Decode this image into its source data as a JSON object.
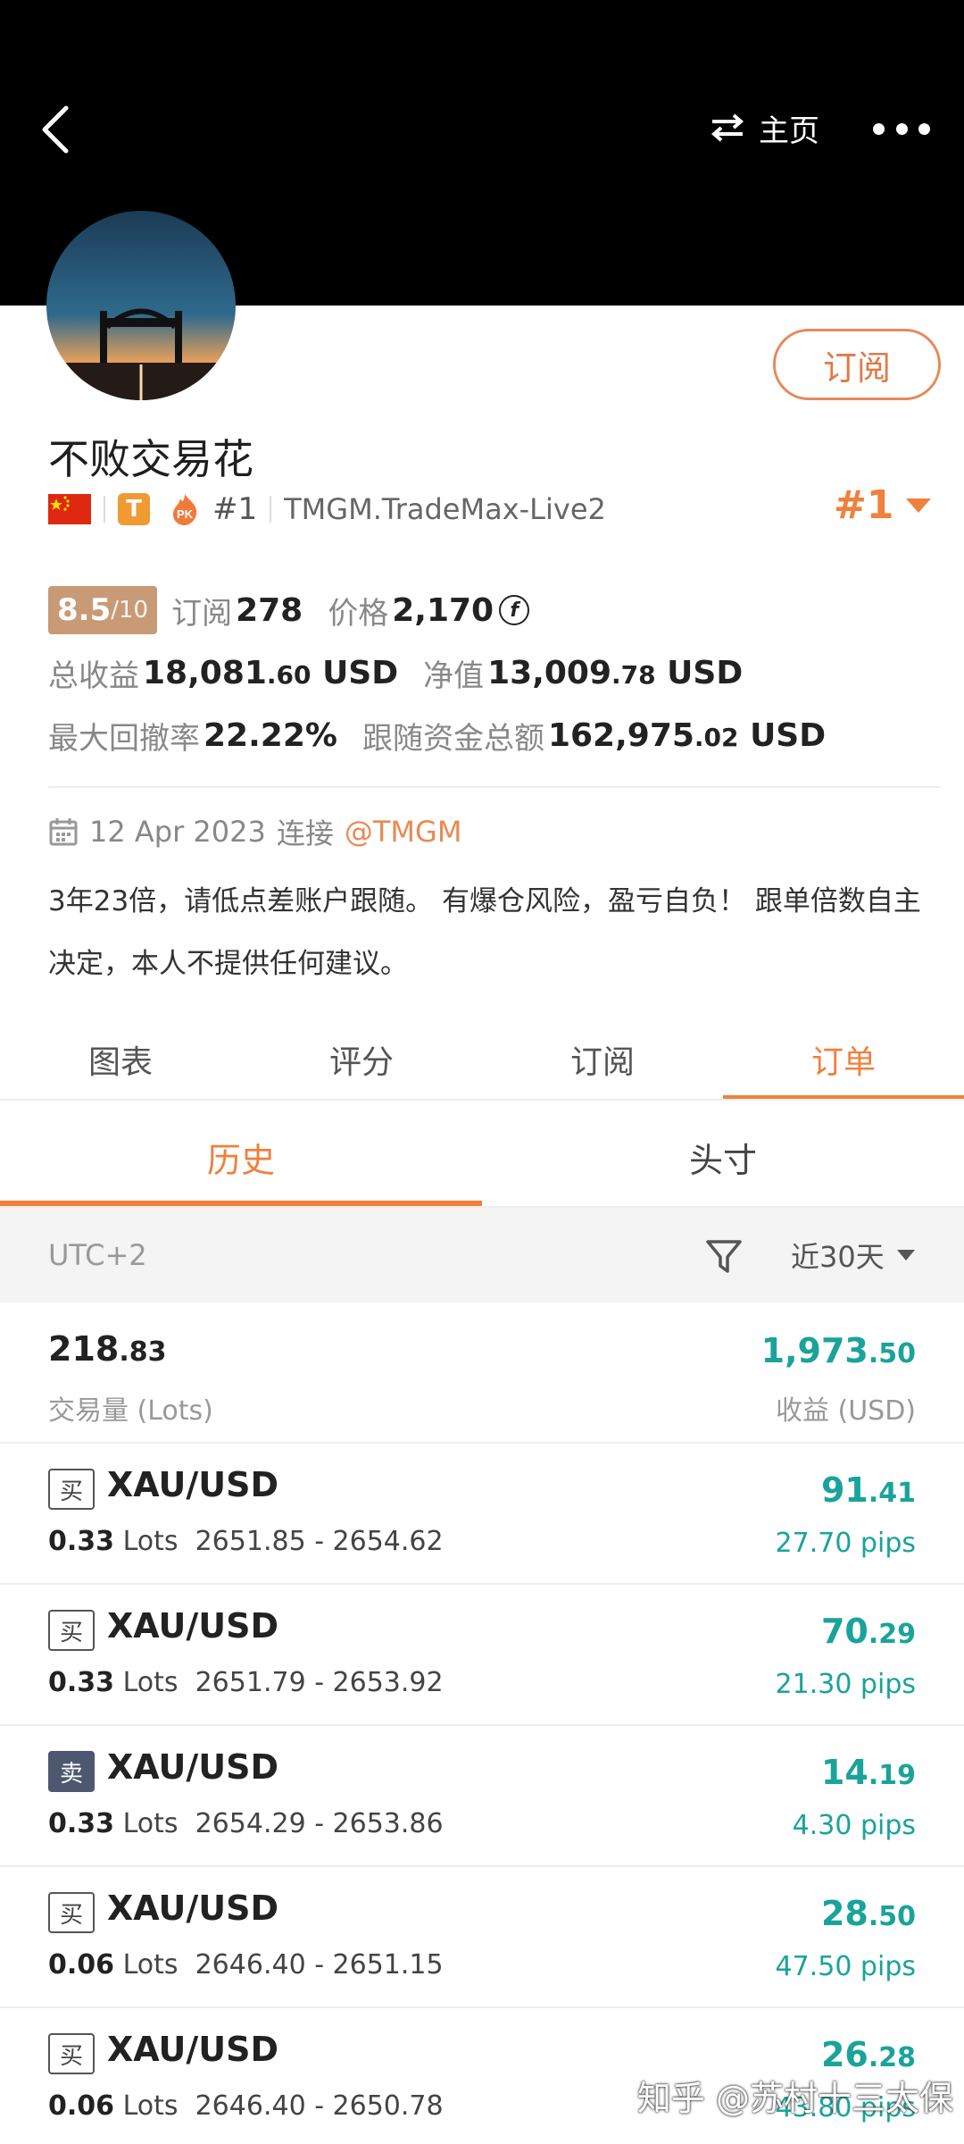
{
  "header": {
    "switch_label": "主页"
  },
  "profile": {
    "subscribe_label": "订阅",
    "name": "不败交易花",
    "rank_tag": "#1",
    "server": "TMGM.TradeMax-Live2",
    "rank_big": "#1",
    "score": "8.5",
    "score_denominator": "/10"
  },
  "stats": {
    "subs_label": "订阅",
    "subs_value": "278",
    "price_label": "价格",
    "price_value": "2,170",
    "coin_symbol": "f",
    "total_profit_label": "总收益",
    "total_profit_main": "18,081",
    "total_profit_dec": ".60",
    "total_profit_unit": " USD",
    "equity_label": "净值",
    "equity_main": "13,009",
    "equity_dec": ".78",
    "equity_unit": " USD",
    "drawdown_label": "最大回撤率",
    "drawdown_value": "22.22%",
    "follow_label": "跟随资金总额",
    "follow_main": "162,975",
    "follow_dec": ".02",
    "follow_unit": " USD"
  },
  "connection": {
    "date": "12 Apr 2023",
    "connect_label": "连接",
    "broker": "@TMGM"
  },
  "description": "3年23倍，请低点差账户跟随。 有爆仓风险，盈亏自负！ 跟单倍数自主决定，本人不提供任何建议。",
  "tabs": [
    "图表",
    "评分",
    "订阅",
    "订单"
  ],
  "subtabs": [
    "历史",
    "头寸"
  ],
  "filter": {
    "timezone": "UTC+2",
    "period": "近30天"
  },
  "summary": {
    "lots_main": "218",
    "lots_dec": ".83",
    "lots_label": "交易量 (Lots)",
    "profit_main": "1,973",
    "profit_dec": ".50",
    "profit_label": "收益 (USD)"
  },
  "orders": [
    {
      "side": "买",
      "symbol": "XAU/USD",
      "lots": "0.33",
      "lots_unit": "Lots",
      "range": "2651.85 - 2654.62",
      "profit_main": "91",
      "profit_dec": ".41",
      "pips": "27.70 pips"
    },
    {
      "side": "买",
      "symbol": "XAU/USD",
      "lots": "0.33",
      "lots_unit": "Lots",
      "range": "2651.79 - 2653.92",
      "profit_main": "70",
      "profit_dec": ".29",
      "pips": "21.30 pips"
    },
    {
      "side": "卖",
      "symbol": "XAU/USD",
      "lots": "0.33",
      "lots_unit": "Lots",
      "range": "2654.29 - 2653.86",
      "profit_main": "14",
      "profit_dec": ".19",
      "pips": "4.30 pips"
    },
    {
      "side": "买",
      "symbol": "XAU/USD",
      "lots": "0.06",
      "lots_unit": "Lots",
      "range": "2646.40 - 2651.15",
      "profit_main": "28",
      "profit_dec": ".50",
      "pips": "47.50 pips"
    },
    {
      "side": "买",
      "symbol": "XAU/USD",
      "lots": "0.06",
      "lots_unit": "Lots",
      "range": "2646.40 - 2650.78",
      "profit_main": "26",
      "profit_dec": ".28",
      "pips": "43.80 pips"
    }
  ],
  "watermark": "知乎 @苏村十三太保",
  "colors": {
    "accent": "#f0803c",
    "profit": "#1aa39a",
    "header_bg": "#000000",
    "score_bg": "#c89a76"
  }
}
